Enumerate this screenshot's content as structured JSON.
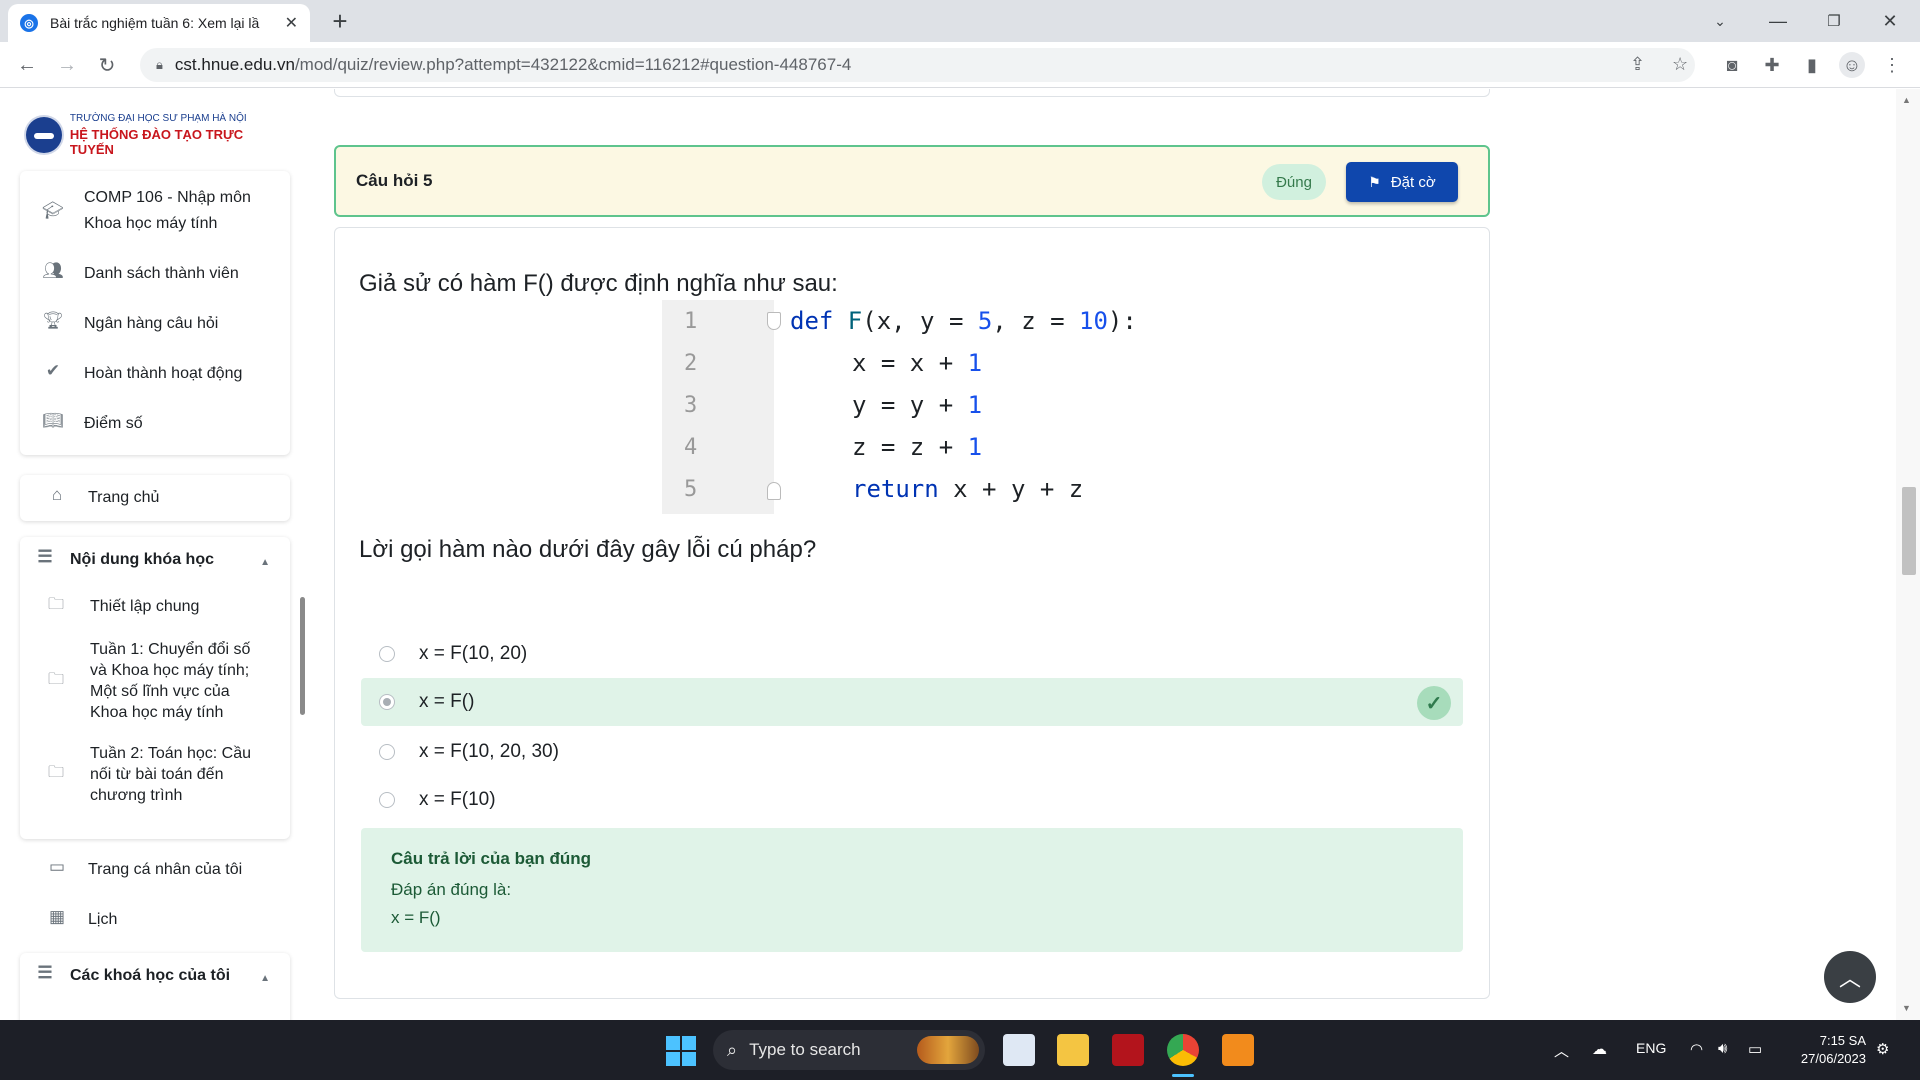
{
  "browser": {
    "tab_title": "Bài trắc nghiệm tuần 6: Xem lại lầ",
    "url_host": "cst.hnue.edu.vn",
    "url_path": "/mod/quiz/review.php?attempt=432122&cmid=116212#question-448767-4",
    "new_tab": "+",
    "close_tab": "✕"
  },
  "logo": {
    "line1": "TRƯỜNG ĐẠI HỌC SƯ PHẠM HÀ NỘI",
    "line2": "HỆ THỐNG ĐÀO TẠO TRỰC TUYẾN"
  },
  "course_nav": [
    {
      "label": "COMP 106 - Nhập môn Khoa học máy tính",
      "icon": "graduation-cap-icon"
    },
    {
      "label": "Danh sách thành viên",
      "icon": "users-icon"
    },
    {
      "label": "Ngân hàng câu hỏi",
      "icon": "trophy-icon"
    },
    {
      "label": "Hoàn thành hoạt động",
      "icon": "check-icon"
    },
    {
      "label": "Điểm số",
      "icon": "book-icon"
    }
  ],
  "site_nav": {
    "home": "Trang chủ",
    "course_content": "Nội dung khóa học",
    "sections": [
      "Thiết lập chung",
      "Tuần 1: Chuyển đổi số và Khoa học máy tính; Một số lĩnh vực của Khoa học máy tính",
      "Tuần 2: Toán học: Cầu nối từ bài toán đến chương trình"
    ],
    "profile": "Trang cá nhân của tôi",
    "calendar": "Lịch",
    "my_courses": "Các khoá học của tôi"
  },
  "question": {
    "number_label": "Câu hỏi 5",
    "state": "Đúng",
    "flag_label": "Đặt cờ",
    "intro": "Giả sử có hàm F() được định nghĩa như sau:",
    "code_lines": [
      {
        "n": "1",
        "parts": [
          [
            "kw",
            "def "
          ],
          [
            "fn",
            "F"
          ],
          [
            "t",
            "(x, y = "
          ],
          [
            "num",
            "5"
          ],
          [
            "t",
            ", z = "
          ],
          [
            "num",
            "10"
          ],
          [
            "t",
            "):"
          ]
        ]
      },
      {
        "n": "2",
        "parts": [
          [
            "t",
            "x = x + "
          ],
          [
            "num",
            "1"
          ]
        ]
      },
      {
        "n": "3",
        "parts": [
          [
            "t",
            "y = y + "
          ],
          [
            "num",
            "1"
          ]
        ]
      },
      {
        "n": "4",
        "parts": [
          [
            "t",
            "z = z + "
          ],
          [
            "num",
            "1"
          ]
        ]
      },
      {
        "n": "5",
        "parts": [
          [
            "kw",
            "return"
          ],
          [
            "t",
            " x + y + z"
          ]
        ]
      }
    ],
    "prompt": "Lời gọi hàm nào dưới đây gây lỗi cú pháp?",
    "options": [
      {
        "text": "x = F(10, 20)",
        "selected": false,
        "correct": false
      },
      {
        "text": "x = F()",
        "selected": true,
        "correct": true
      },
      {
        "text": "x = F(10, 20, 30)",
        "selected": false,
        "correct": false
      },
      {
        "text": "x = F(10)",
        "selected": false,
        "correct": false
      }
    ],
    "feedback_title": "Câu trả lời của bạn đúng",
    "feedback_correct_label": "Đáp án đúng là:",
    "feedback_answer": "x = F()"
  },
  "taskbar": {
    "search_placeholder": "Type to search",
    "lang": "ENG",
    "time": "7:15 SA",
    "date": "27/06/2023"
  },
  "colors": {
    "accent_blue": "#0f47ad",
    "correct_green": "#e0f3e8",
    "info_yellow": "#fcf8e3"
  }
}
